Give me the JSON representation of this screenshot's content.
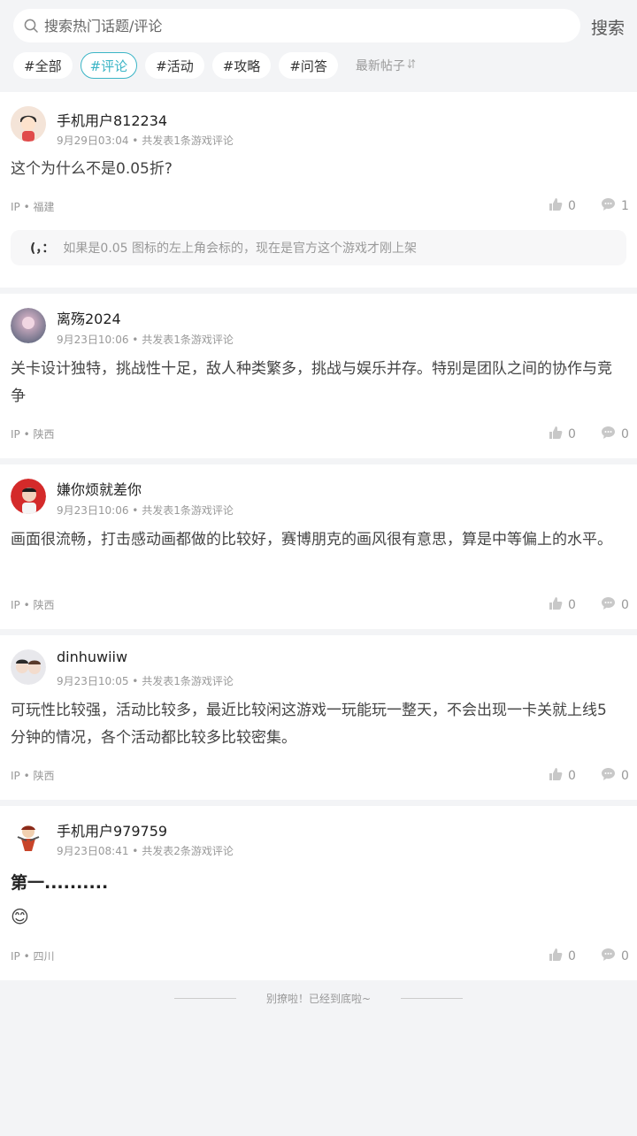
{
  "search": {
    "placeholder": "搜索热门话题/评论",
    "button_label": "搜索"
  },
  "tabs": [
    {
      "label": "#全部"
    },
    {
      "label": "#评论"
    },
    {
      "label": "#活动"
    },
    {
      "label": "#攻略"
    },
    {
      "label": "#问答"
    }
  ],
  "sort_label": "最新帖子",
  "colors": {
    "accent": "#3bb5c6",
    "background": "#f3f4f6"
  },
  "posts": [
    {
      "username": "手机用户812234",
      "meta": "9月29日03:04 • 共发表1条游戏评论",
      "content": "这个为什么不是0.05折?",
      "ip": "IP • 福建",
      "likes": "0",
      "comments": "1",
      "reply": {
        "name": "(，：",
        "text": "如果是0.05 图标的左上角会标的，现在是官方这个游戏才刚上架"
      }
    },
    {
      "username": "离殇2024",
      "meta": "9月23日10:06 • 共发表1条游戏评论",
      "content": "关卡设计独特，挑战性十足，敌人种类繁多，挑战与娱乐并存。特别是团队之间的协作与竞争",
      "ip": "IP • 陕西",
      "likes": "0",
      "comments": "0"
    },
    {
      "username": "嫌你烦就差你",
      "meta": "9月23日10:06 • 共发表1条游戏评论",
      "content": "画面很流畅，打击感动画都做的比较好，赛博朋克的画风很有意思，算是中等偏上的水平。",
      "ip": "IP • 陕西",
      "likes": "0",
      "comments": "0"
    },
    {
      "username": "dinhuwiiw",
      "meta": "9月23日10:05 • 共发表1条游戏评论",
      "content": "可玩性比较强，活动比较多，最近比较闲这游戏一玩能玩一整天，不会出现一卡关就上线5分钟的情况，各个活动都比较多比较密集。",
      "ip": "IP • 陕西",
      "likes": "0",
      "comments": "0"
    },
    {
      "username": "手机用户979759",
      "meta": "9月23日08:41 • 共发表2条游戏评论",
      "content": "第一..........",
      "emoji": "😊",
      "ip": "IP • 四川",
      "likes": "0",
      "comments": "0"
    }
  ],
  "footer_text": "别撩啦！已经到底啦~"
}
